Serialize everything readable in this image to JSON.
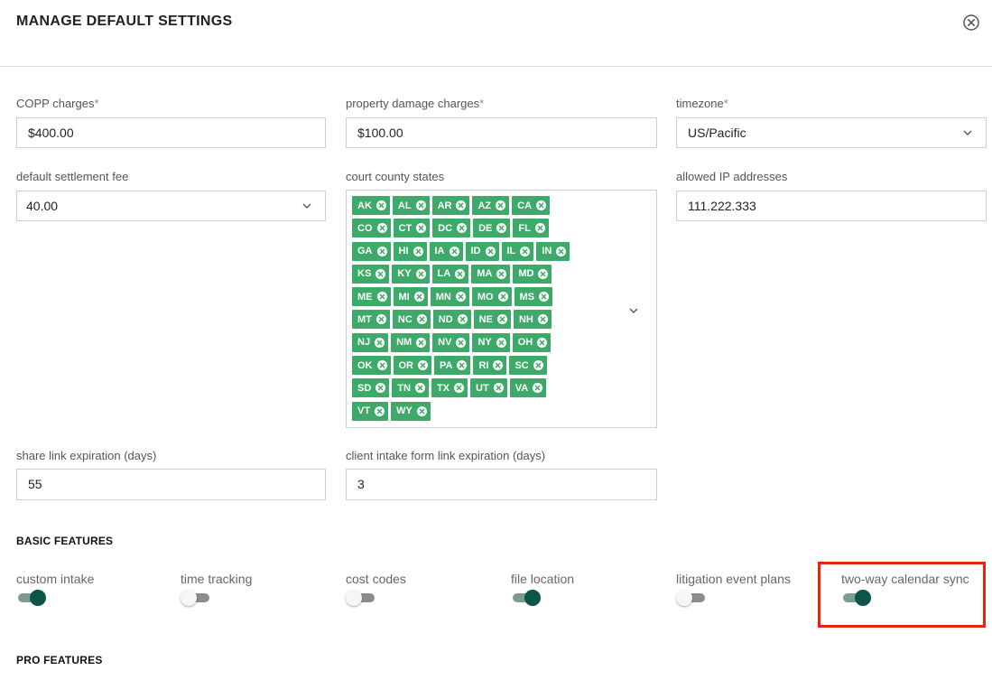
{
  "header": {
    "title": "MANAGE DEFAULT SETTINGS",
    "close_icon": "close-circle-icon"
  },
  "fields": {
    "copp_charges": {
      "label": "COPP charges",
      "required": "*",
      "value": "$400.00"
    },
    "property_damage_charges": {
      "label": "property damage charges",
      "required": "*",
      "value": "$100.00"
    },
    "timezone": {
      "label": "timezone",
      "required": "*",
      "value": "US/Pacific"
    },
    "default_settlement_fee": {
      "label": "default settlement fee",
      "value": "40.00"
    },
    "court_county_states": {
      "label": "court county states",
      "tags": [
        [
          "AK",
          "AL",
          "AR",
          "AZ",
          "CA"
        ],
        [
          "CO",
          "CT",
          "DC",
          "DE",
          "FL"
        ],
        [
          "GA",
          "HI",
          "IA",
          "ID",
          "IL",
          "IN"
        ],
        [
          "KS",
          "KY",
          "LA",
          "MA",
          "MD"
        ],
        [
          "ME",
          "MI",
          "MN",
          "MO",
          "MS"
        ],
        [
          "MT",
          "NC",
          "ND",
          "NE",
          "NH"
        ],
        [
          "NJ",
          "NM",
          "NV",
          "NY",
          "OH"
        ],
        [
          "OK",
          "OR",
          "PA",
          "RI",
          "SC"
        ],
        [
          "SD",
          "TN",
          "TX",
          "UT",
          "VA"
        ],
        [
          "VT",
          "WY"
        ]
      ]
    },
    "allowed_ip_addresses": {
      "label": "allowed IP addresses",
      "value": "111.222.333"
    },
    "share_link_expiration": {
      "label": "share link expiration (days)",
      "value": "55"
    },
    "client_intake_form_link_expiration": {
      "label": "client intake form link expiration (days)",
      "value": "3"
    }
  },
  "basic_features": {
    "title": "BASIC FEATURES",
    "items": [
      {
        "label": "custom intake",
        "enabled": true
      },
      {
        "label": "time tracking",
        "enabled": false
      },
      {
        "label": "cost codes",
        "enabled": false
      },
      {
        "label": "file location",
        "enabled": true
      },
      {
        "label": "litigation event plans",
        "enabled": false
      },
      {
        "label": "two-way calendar sync",
        "enabled": true
      }
    ]
  },
  "pro_features": {
    "title": "PRO FEATURES"
  },
  "colors": {
    "tag_green": "#3daa69",
    "toggle_on_knob": "#0d5449",
    "toggle_on_track": "#7d9b93",
    "highlight_red": "#e8230e"
  }
}
